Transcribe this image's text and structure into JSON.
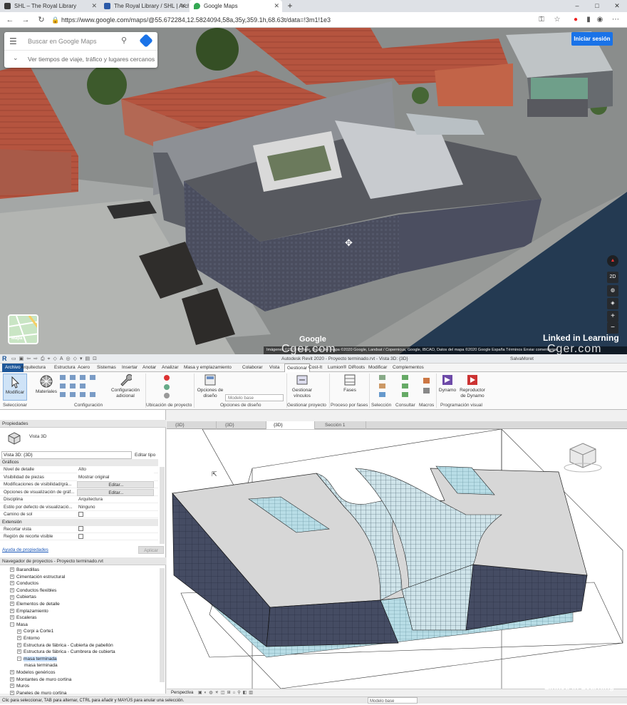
{
  "browser": {
    "tabs": [
      {
        "label": "SHL – The Royal Library"
      },
      {
        "label": "The Royal Library / SHL | ArchDa"
      },
      {
        "label": "Google Maps"
      }
    ],
    "url": "https://www.google.com/maps/@55.672284,12.5824094,58a,35y,359.1h,68.63t/data=!3m1!1e3",
    "new_tab": "+",
    "window_minimize": "–",
    "window_maximize": "□",
    "window_close": "✕"
  },
  "maps": {
    "search_placeholder": "Buscar en Google Maps",
    "travel_time": "Ver tiempos de viaje, tráfico y lugares cercanos",
    "signin": "Iniciar sesión",
    "minimap_label": "Mapa",
    "control_2d": "2D",
    "google_logo": "Google",
    "attribution": "Imágenes ©2020 Google, Datos del mapa ©2020 Google, Landsat / Copernicus, Google, IBCAO, Datos del mapa ©2020 Google   España   Términos   Enviar comentarios",
    "watermark": "Cger.com",
    "linkedin": "Linked in Learning"
  },
  "revit": {
    "title": "Autodesk Revit 2020 - Proyecto terminado.rvt - Vista 3D: {3D}",
    "user": "SalvaMoret",
    "menu_tabs": [
      "Archivo",
      "Arquitectura",
      "Estructura",
      "Acero",
      "Sistemas",
      "Insertar",
      "Anotar",
      "Analizar",
      "Masa y emplazamiento",
      "Colaborar",
      "Vista",
      "Gestionar",
      "Cost-It",
      "Lumion®",
      "DiRoots",
      "Modificar",
      "Complementos"
    ],
    "ribbon": {
      "modificar": "Modificar",
      "materiales": "Materiales",
      "config_adicional": "Configuración adicional",
      "opciones_diseno": "Opciones de diseño",
      "modelo_base": "Modelo base",
      "gestionar_vinculos": "Gestionar vínculos",
      "fases": "Fases",
      "dynamo": "Dynamo",
      "reproductor": "Reproductor de Dynamo",
      "groups": [
        "Seleccionar",
        "Configuración",
        "Ubicación de proyecto",
        "Opciones de diseño",
        "Gestionar proyecto",
        "Proceso por fases",
        "Selección",
        "Consultar",
        "Macros",
        "Programación visual"
      ]
    },
    "properties": {
      "header": "Propiedades",
      "type_name": "Vista 3D",
      "view_selector": "Vista 3D: {3D}",
      "edit_type": "Editar tipo",
      "cat_graficos": "Gráficos",
      "rows": [
        {
          "k": "Nivel de detalle",
          "v": "Alto"
        },
        {
          "k": "Visibilidad de piezas",
          "v": "Mostrar original"
        },
        {
          "k": "Modificaciones de visibilidad/grá...",
          "v": "Editar..."
        },
        {
          "k": "Opciones de visualización de gráf...",
          "v": "Editar..."
        },
        {
          "k": "Disciplina",
          "v": "Arquitectura"
        },
        {
          "k": "Estilo por defecto de visualizació...",
          "v": "Ninguno"
        },
        {
          "k": "Camino de sol",
          "v": ""
        }
      ],
      "cat_extension": "Extensión",
      "rows2": [
        {
          "k": "Recortar vista",
          "v": ""
        },
        {
          "k": "Región de recorte visible",
          "v": ""
        }
      ],
      "help": "Ayuda de propiedades",
      "apply": "Aplicar"
    },
    "navigator": {
      "header": "Navegador de proyectos - Proyecto terminado.rvt",
      "items": [
        {
          "label": "Barandillas",
          "level": 1,
          "pm": "+"
        },
        {
          "label": "Cimentación estructural",
          "level": 1,
          "pm": "+"
        },
        {
          "label": "Conductos",
          "level": 1,
          "pm": "+"
        },
        {
          "label": "Conductos flexibles",
          "level": 1,
          "pm": "+"
        },
        {
          "label": "Cubiertas",
          "level": 1,
          "pm": "+"
        },
        {
          "label": "Elementos de detalle",
          "level": 1,
          "pm": "+"
        },
        {
          "label": "Emplazamiento",
          "level": 1,
          "pm": "+"
        },
        {
          "label": "Escaleras",
          "level": 1,
          "pm": "+"
        },
        {
          "label": "Masa",
          "level": 1,
          "pm": "-"
        },
        {
          "label": "Corpi a Corte1",
          "level": 2,
          "pm": "+"
        },
        {
          "label": "Entorno",
          "level": 2,
          "pm": "+"
        },
        {
          "label": "Estructura de fábrica - Cubierta de pabellón",
          "level": 2,
          "pm": "+"
        },
        {
          "label": "Estructura de fábrica - Cumbrera de cubierta",
          "level": 2,
          "pm": "+"
        },
        {
          "label": "masa terminada",
          "level": 2,
          "pm": "-",
          "selected": true
        },
        {
          "label": "masa terminada",
          "level": 3,
          "pm": ""
        },
        {
          "label": "Modelos genéricos",
          "level": 1,
          "pm": "+"
        },
        {
          "label": "Montantes de muro cortina",
          "level": 1,
          "pm": "+"
        },
        {
          "label": "Muros",
          "level": 1,
          "pm": "+"
        },
        {
          "label": "Paneles de muro cortina",
          "level": 1,
          "pm": "+"
        }
      ]
    },
    "view_tabs": [
      "{3D}",
      "{3D}",
      "{3D}",
      "Sección 1"
    ],
    "view_control": "Perspectiva",
    "status": "Clic para seleccionar, TAB para alternar, CTRL para añadir y MAYÚS para anular una selección.",
    "status_model": "Modelo base",
    "watermark": "Cger.com"
  }
}
